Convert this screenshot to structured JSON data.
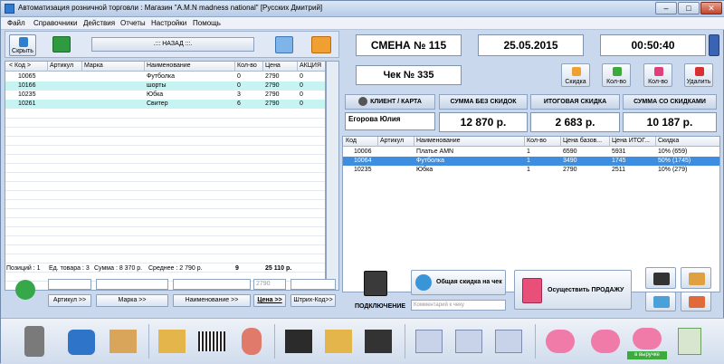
{
  "window": {
    "title": "Автоматизация розничной торговли : Магазин \"A.M.N madness national\" [Русских Дмитрий]",
    "controls": [
      "–",
      "□",
      "✕"
    ]
  },
  "menu": [
    "Файл",
    "Справочники",
    "Действия",
    "Отчеты",
    "Настройки",
    "Помощь"
  ],
  "left_toolbar": {
    "hide_label": "Скрыть",
    "back_label": ".::: НАЗАД :::."
  },
  "products": {
    "columns": [
      "< Код >",
      "Артикул",
      "Марка",
      "Наименование",
      "Кол-во",
      "Цена",
      "АКЦИЯ"
    ],
    "rows": [
      [
        "10065",
        "",
        "",
        "Футболка",
        "0",
        "2790",
        "0"
      ],
      [
        "10166",
        "",
        "",
        "шорты",
        "0",
        "2790",
        "0"
      ],
      [
        "10235",
        "",
        "",
        "Юбка",
        "3",
        "2790",
        "0"
      ],
      [
        "10261",
        "",
        "",
        "Свитер",
        "6",
        "2790",
        "0"
      ]
    ]
  },
  "status": {
    "positions": "Позиций : 1",
    "units": "Ед. товара : 3",
    "sum": "Сумма : 8 370 р.",
    "average": "Среднее : 2 790 р.",
    "count": "9",
    "total": "25 110 р."
  },
  "filters": {
    "article": "Артикул >>",
    "brand": "Марка >>",
    "name": "Наименование >>",
    "price_value": "2790",
    "price": "Цена >>",
    "barcode": "Штрих-Код>>"
  },
  "shift": {
    "label": "СМЕНА № 115",
    "date": "25.05.2015",
    "time": "00:50:40"
  },
  "receipt": {
    "label": "Чек № 335",
    "actions": [
      "Скидка",
      "Кол-во",
      "Кол-во",
      "Удалить"
    ]
  },
  "summary": {
    "client_header": "КЛИЕНТ / КАРТА",
    "subtotal_header": "СУММА БЕЗ СКИДОК",
    "discount_header": "ИТОГОВАЯ СКИДКА",
    "total_header": "СУММА СО СКИДКАМИ",
    "client": "Егорова Юлия",
    "subtotal": "12 870 р.",
    "discount": "2 683 р.",
    "total": "10 187 р."
  },
  "receipt_items": {
    "columns": [
      "Код",
      "Артикул",
      "Наименование",
      "Кол-во",
      "Цена базов...",
      "Цена ИТОГ...",
      "Скидка"
    ],
    "rows": [
      [
        "10006",
        "",
        "Платье AMN",
        "1",
        "6590",
        "5931",
        "10% (659)"
      ],
      [
        "10064",
        "",
        "Футболка",
        "1",
        "3490",
        "1745",
        "50% (1745)"
      ],
      [
        "10235",
        "",
        "Юбка",
        "1",
        "2790",
        "2511",
        "10% (279)"
      ]
    ]
  },
  "bottom": {
    "connect_label": "ПОДКЛЮЧЕНИЕ",
    "total_discount_label": "Общая скидка на чек",
    "comment_placeholder": "Комментарий к чеку",
    "sell_label": "Осуществить ПРОДАЖУ"
  },
  "taskbar": {
    "revenue_label": "в выручке"
  },
  "colors": {
    "accent": "#3d8ee0",
    "row_highlight": "#c8f3f3",
    "selected": "#3d8ee0"
  }
}
